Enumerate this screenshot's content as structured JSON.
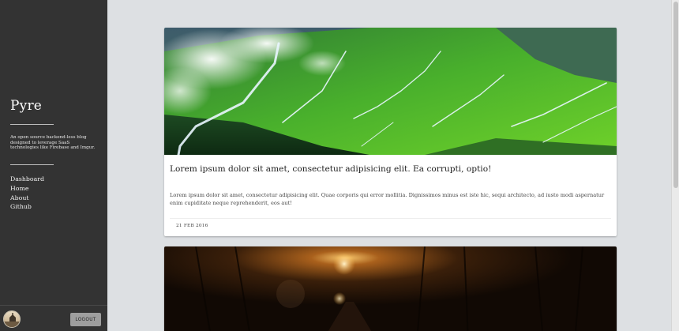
{
  "sidebar": {
    "brand": "Pyre",
    "tagline": "An open source backend-less blog designed to leverage SaaS technologies like Firebase and Imgur.",
    "nav": [
      {
        "label": "Dashboard",
        "icon": null
      },
      {
        "label": "Home",
        "icon": null
      },
      {
        "label": "About",
        "icon": null
      },
      {
        "label": "Github",
        "icon": null
      }
    ],
    "logout_label": "LOGOUT",
    "avatar_icon": "avatar-icon"
  },
  "posts": [
    {
      "title": "Lorem ipsum dolor sit amet, consectetur adipisicing elit. Ea corrupti, optio!",
      "excerpt": "Lorem ipsum dolor sit amet, consectetur adipisicing elit. Quae corporis qui error mollitia. Dignissimos minus est iste hic, sequi architecto, ad iusto modi aspernatur enim cupiditate neque reprehenderit, eos aut!",
      "date": "21 FEB 2016",
      "image": "mountain-valley-photo"
    },
    {
      "title": "",
      "excerpt": "",
      "date": "",
      "image": "night-forest-road-photo"
    }
  ],
  "colors": {
    "sidebar_bg": "#333333",
    "page_bg": "#dde0e3",
    "card_bg": "#ffffff",
    "logout_bg": "#9e9e9e"
  }
}
